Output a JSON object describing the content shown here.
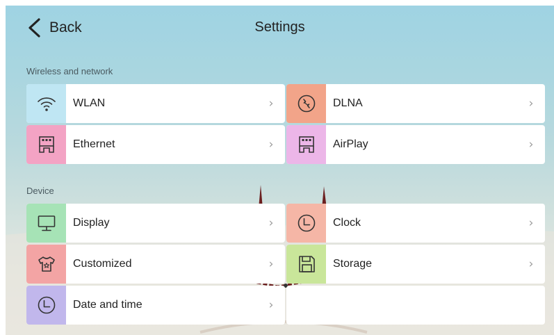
{
  "header": {
    "back_label": "Back",
    "title": "Settings"
  },
  "sections": [
    {
      "label": "Wireless and network",
      "items": [
        {
          "label": "WLAN",
          "icon": "wifi-icon",
          "color": "#bfe6f3"
        },
        {
          "label": "DLNA",
          "icon": "dlna-icon",
          "color": "#f2a489"
        },
        {
          "label": "Ethernet",
          "icon": "ethernet-icon",
          "color": "#f3a3c4"
        },
        {
          "label": "AirPlay",
          "icon": "airplay-icon",
          "color": "#ecb6e8"
        }
      ]
    },
    {
      "label": "Device",
      "items": [
        {
          "label": "Display",
          "icon": "monitor-icon",
          "color": "#a6e3b6"
        },
        {
          "label": "Clock",
          "icon": "clock-icon",
          "color": "#f5b6a6"
        },
        {
          "label": "Customized",
          "icon": "shirt-icon",
          "color": "#f3a4a4"
        },
        {
          "label": "Storage",
          "icon": "floppy-disk-icon",
          "color": "#c9e69a"
        },
        {
          "label": "Date and time",
          "icon": "clock-icon",
          "color": "#c1b7ec"
        }
      ]
    }
  ],
  "chevron": "›"
}
